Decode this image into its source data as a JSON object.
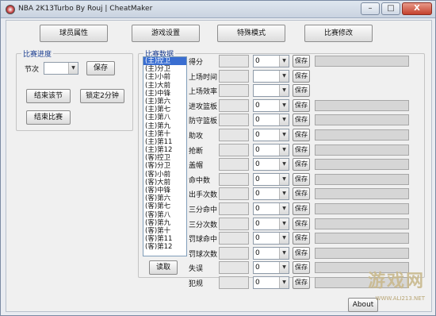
{
  "window": {
    "title": "NBA 2K13Turbo By Rouj | CheatMaker",
    "minimize": "–",
    "maximize": "□",
    "close": "X"
  },
  "tabs": [
    "球员属性",
    "游戏设置",
    "特殊模式",
    "比赛修改"
  ],
  "progress_group": {
    "title": "比赛进度",
    "quarter_label": "节次",
    "quarter_value": "",
    "save_label": "保存",
    "end_quarter": "结束该节",
    "lock_2min": "锁定2分钟",
    "end_game": "结束比赛"
  },
  "stats_group": {
    "title": "比赛数据",
    "players": [
      "(主)控卫",
      "(主)分卫",
      "(主)小前",
      "(主)大前",
      "(主)中锋",
      "(主)第六",
      "(主)第七",
      "(主)第八",
      "(主)第九",
      "(主)第十",
      "(主)第11",
      "(主)第12",
      "(客)控卫",
      "(客)分卫",
      "(客)小前",
      "(客)大前",
      "(客)中锋",
      "(客)第六",
      "(客)第七",
      "(客)第八",
      "(客)第九",
      "(客)第十",
      "(客)第11",
      "(客)第12"
    ],
    "read_label": "读取",
    "rows": [
      {
        "label": "得分",
        "value": "0",
        "save": "保存",
        "has_bar": true
      },
      {
        "label": "上场时间",
        "value": "",
        "save": "保存",
        "has_bar": false
      },
      {
        "label": "上场效率",
        "value": "",
        "save": "保存",
        "has_bar": false
      },
      {
        "label": "进攻篮板",
        "value": "0",
        "save": "保存",
        "has_bar": true
      },
      {
        "label": "防守篮板",
        "value": "0",
        "save": "保存",
        "has_bar": true
      },
      {
        "label": "助攻",
        "value": "0",
        "save": "保存",
        "has_bar": true
      },
      {
        "label": "抢断",
        "value": "0",
        "save": "保存",
        "has_bar": true
      },
      {
        "label": "盖帽",
        "value": "0",
        "save": "保存",
        "has_bar": true
      },
      {
        "label": "命中数",
        "value": "0",
        "save": "保存",
        "has_bar": true
      },
      {
        "label": "出手次数",
        "value": "0",
        "save": "保存",
        "has_bar": true
      },
      {
        "label": "三分命中",
        "value": "0",
        "save": "保存",
        "has_bar": true
      },
      {
        "label": "三分次数",
        "value": "0",
        "save": "保存",
        "has_bar": true
      },
      {
        "label": "罚球命中",
        "value": "0",
        "save": "保存",
        "has_bar": true
      },
      {
        "label": "罚球次数",
        "value": "0",
        "save": "保存",
        "has_bar": true
      },
      {
        "label": "失误",
        "value": "0",
        "save": "保存",
        "has_bar": true
      },
      {
        "label": "犯规",
        "value": "0",
        "save": "保存",
        "has_bar": true
      }
    ]
  },
  "about_label": "About",
  "watermark": {
    "text": "游戏网",
    "url": "WWW.ALI213.NET"
  }
}
